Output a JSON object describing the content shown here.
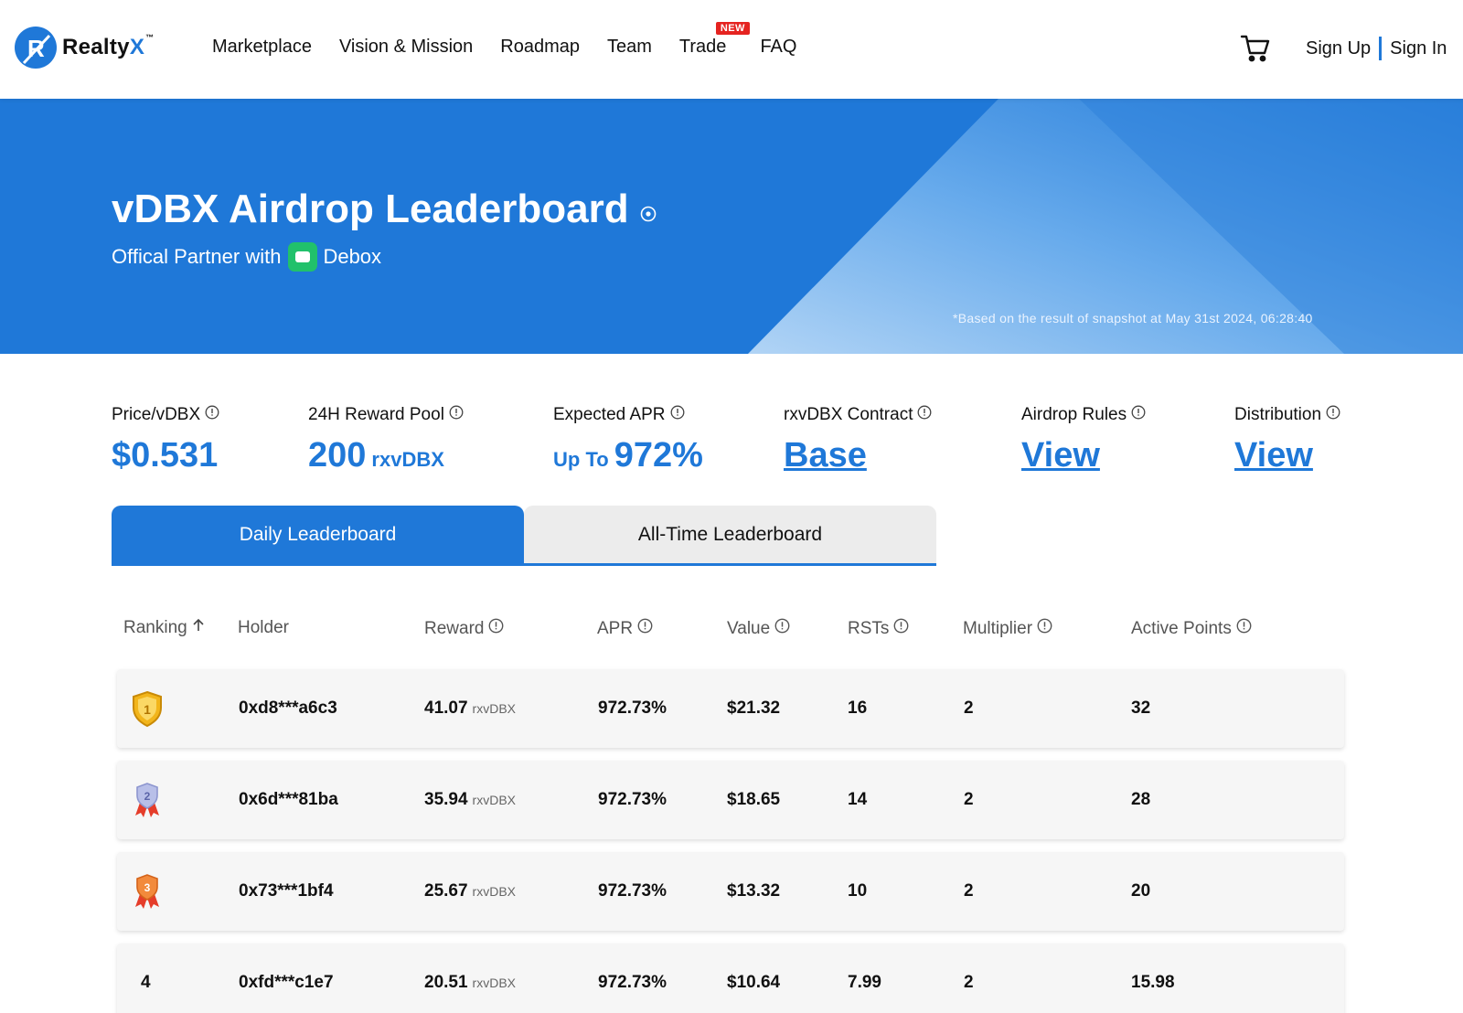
{
  "header": {
    "logo_text": "Realty",
    "logo_x": "X",
    "logo_tm": "™",
    "nav": [
      {
        "label": "Marketplace"
      },
      {
        "label": "Vision & Mission"
      },
      {
        "label": "Roadmap"
      },
      {
        "label": "Team"
      },
      {
        "label": "Trade",
        "badge": "NEW"
      },
      {
        "label": "FAQ"
      }
    ],
    "cart_icon": "cart-icon",
    "sign_up": "Sign Up",
    "sign_in": "Sign In"
  },
  "banner": {
    "title": "vDBX Airdrop Leaderboard",
    "subtitle_prefix": "Offical Partner with",
    "partner": "Debox",
    "snapshot_note": "*Based on the result of snapshot at May 31st 2024, 06:28:40"
  },
  "stats": {
    "price": {
      "label": "Price/vDBX",
      "value": "$0.531"
    },
    "reward_pool": {
      "label": "24H Reward Pool",
      "value": "200",
      "unit": "rxvDBX"
    },
    "apr": {
      "label": "Expected APR",
      "prefix": "Up To",
      "value": "972%"
    },
    "contract": {
      "label": "rxvDBX Contract",
      "link": "Base"
    },
    "rules": {
      "label": "Airdrop Rules",
      "link": "View"
    },
    "distribution": {
      "label": "Distribution",
      "link": "View"
    }
  },
  "tabs": {
    "daily": "Daily Leaderboard",
    "all_time": "All-Time Leaderboard",
    "active": "daily"
  },
  "table": {
    "headers": {
      "ranking": "Ranking",
      "holder": "Holder",
      "reward": "Reward",
      "apr": "APR",
      "value": "Value",
      "rsts": "RSTs",
      "multiplier": "Multiplier",
      "active_points": "Active Points"
    },
    "rows": [
      {
        "rank": "1",
        "holder": "0xd8***a6c3",
        "reward": "41.07",
        "reward_unit": "rxvDBX",
        "apr": "972.73%",
        "value": "$21.32",
        "rsts": "16",
        "multiplier": "2",
        "active_points": "32"
      },
      {
        "rank": "2",
        "holder": "0x6d***81ba",
        "reward": "35.94",
        "reward_unit": "rxvDBX",
        "apr": "972.73%",
        "value": "$18.65",
        "rsts": "14",
        "multiplier": "2",
        "active_points": "28"
      },
      {
        "rank": "3",
        "holder": "0x73***1bf4",
        "reward": "25.67",
        "reward_unit": "rxvDBX",
        "apr": "972.73%",
        "value": "$13.32",
        "rsts": "10",
        "multiplier": "2",
        "active_points": "20"
      },
      {
        "rank": "4",
        "holder": "0xfd***c1e7",
        "reward": "20.51",
        "reward_unit": "rxvDBX",
        "apr": "972.73%",
        "value": "$10.64",
        "rsts": "7.99",
        "multiplier": "2",
        "active_points": "15.98"
      }
    ]
  },
  "colors": {
    "brand": "#1f78d8",
    "badge_red": "#e52320",
    "debox_green": "#21c16b"
  }
}
